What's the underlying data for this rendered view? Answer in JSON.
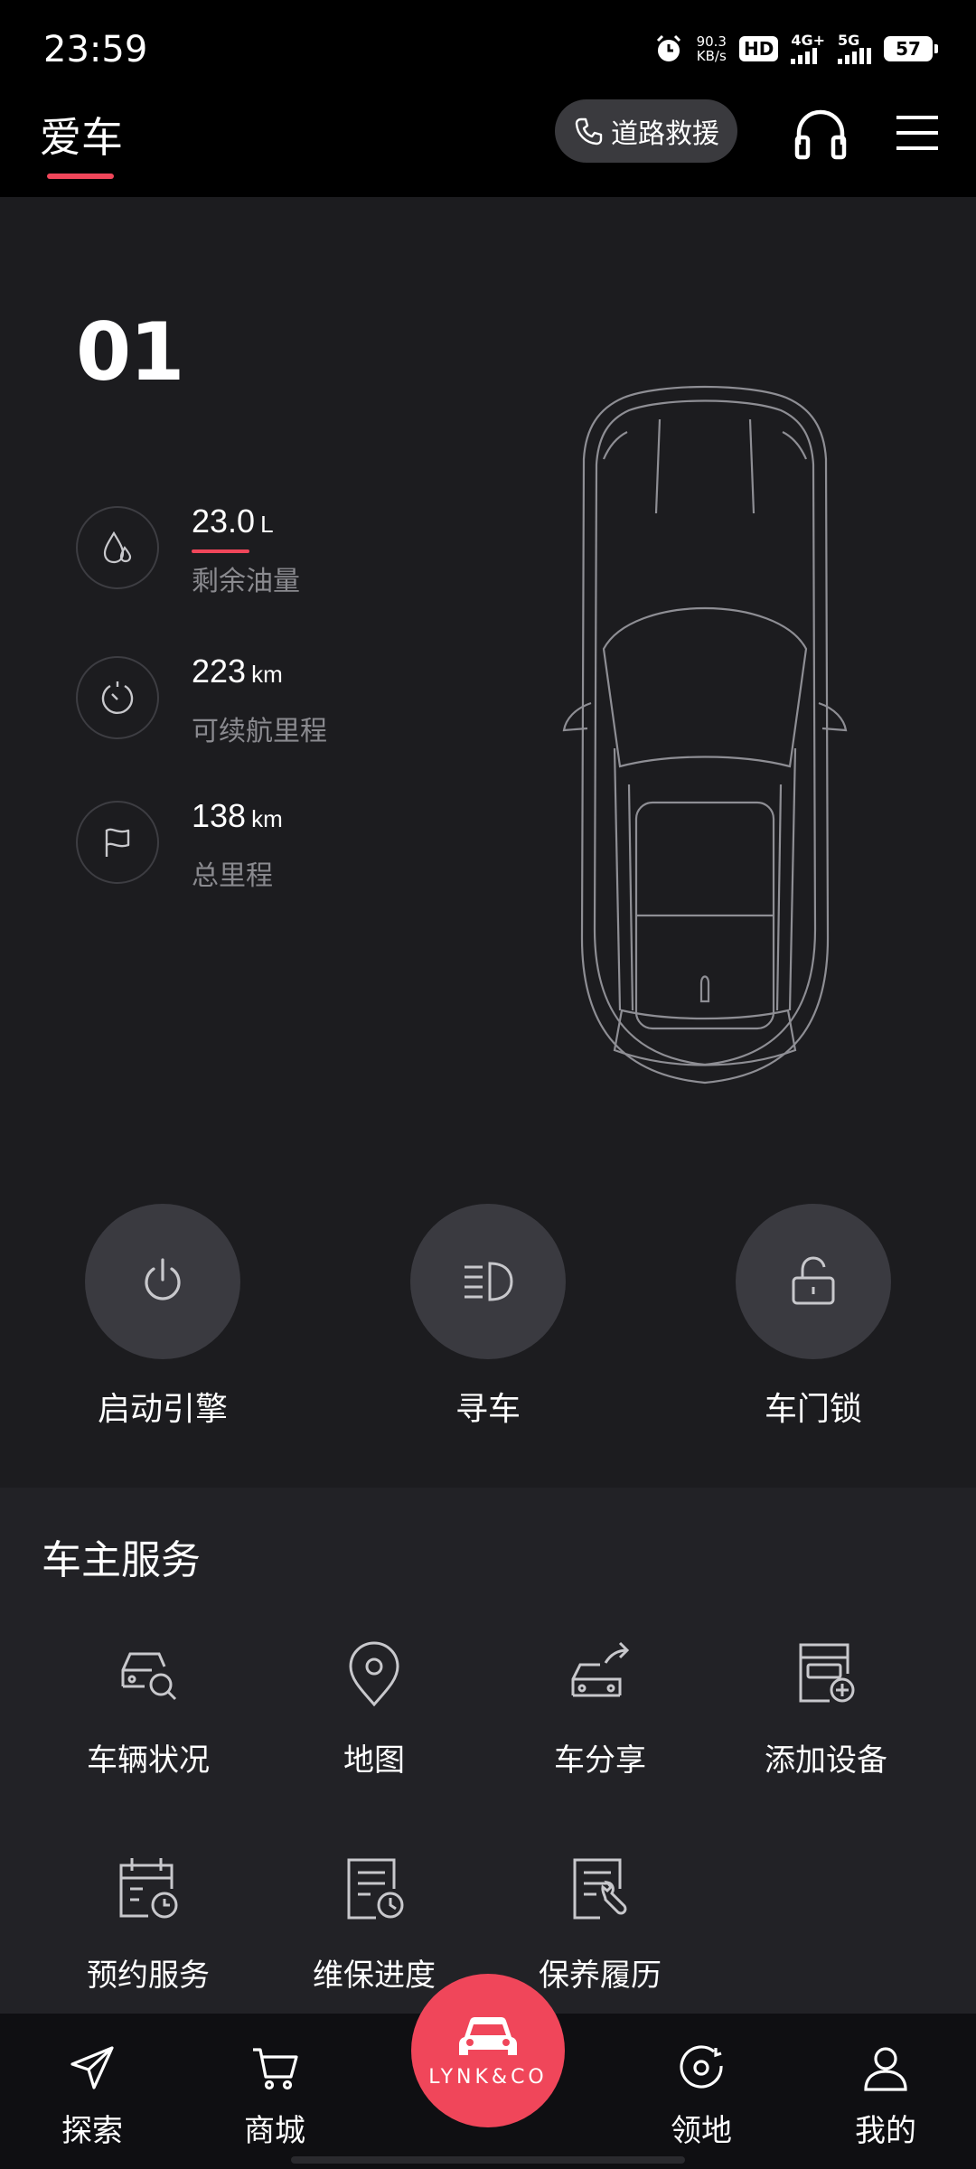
{
  "status_bar": {
    "time": "23:59",
    "net_speed_value": "90.3",
    "net_speed_unit": "KB/s",
    "hd_label": "HD",
    "sim1_label": "4G+",
    "sim2_label": "5G",
    "battery_level": "57"
  },
  "header": {
    "title": "爱车",
    "rescue_label": "道路救援",
    "accent_color": "#f0465a"
  },
  "car": {
    "model": "01",
    "stats": [
      {
        "value": "23.0",
        "unit": "L",
        "label": "剩余油量",
        "icon": "fuel-drop-icon"
      },
      {
        "value": "223",
        "unit": "km",
        "label": "可续航里程",
        "icon": "range-gauge-icon"
      },
      {
        "value": "138",
        "unit": "km",
        "label": "总里程",
        "icon": "flag-icon"
      }
    ],
    "actions": [
      {
        "label": "启动引擎",
        "icon": "power-icon"
      },
      {
        "label": "寻车",
        "icon": "headlight-icon"
      },
      {
        "label": "车门锁",
        "icon": "unlock-icon"
      }
    ]
  },
  "services": {
    "title": "车主服务",
    "items": [
      {
        "label": "车辆状况",
        "icon": "car-search-icon"
      },
      {
        "label": "地图",
        "icon": "map-pin-icon"
      },
      {
        "label": "车分享",
        "icon": "car-share-icon"
      },
      {
        "label": "添加设备",
        "icon": "add-device-icon"
      },
      {
        "label": "预约服务",
        "icon": "calendar-clock-icon"
      },
      {
        "label": "维保进度",
        "icon": "maintenance-progress-icon"
      },
      {
        "label": "保养履历",
        "icon": "service-history-icon"
      }
    ]
  },
  "bottom_nav": {
    "items": [
      {
        "label": "探索",
        "icon": "send-icon"
      },
      {
        "label": "商城",
        "icon": "cart-icon"
      },
      {
        "label": "领地",
        "icon": "territory-icon"
      },
      {
        "label": "我的",
        "icon": "profile-icon"
      }
    ],
    "center_brand": "LYNK&CO"
  }
}
